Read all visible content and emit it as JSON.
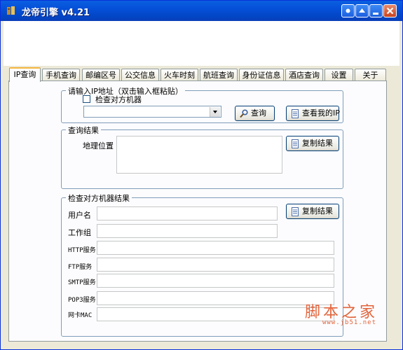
{
  "window": {
    "title": "龙帝引擎 v4.21"
  },
  "tabs": [
    {
      "label": "IP查询",
      "active": true
    },
    {
      "label": "手机查询"
    },
    {
      "label": "邮编区号"
    },
    {
      "label": "公交信息"
    },
    {
      "label": "火车时刻"
    },
    {
      "label": "航班查询"
    },
    {
      "label": "身份证信息"
    },
    {
      "label": "酒店查询"
    },
    {
      "label": "设置"
    },
    {
      "label": "关于"
    }
  ],
  "ip_input": {
    "legend": "请输入IP地址（双击输入框粘贴）",
    "check_remote_label": "检查对方机器",
    "check_remote_checked": false,
    "ip_value": "",
    "query_button": "查询",
    "view_my_ip_button": "查看我的IP"
  },
  "query_result": {
    "legend": "查询结果",
    "location_label": "地理位置",
    "location_value": "",
    "copy_button": "复制结果"
  },
  "remote_result": {
    "legend": "检查对方机器结果",
    "copy_button": "复制结果",
    "fields": {
      "username": "用户名",
      "workgroup": "工作组",
      "http": "HTTP服务",
      "ftp": "FTP服务",
      "smtp": "SMTP服务",
      "pop3": "POP3服务",
      "mac": "网卡MAC"
    }
  },
  "watermark": {
    "text": "脚本之家",
    "url": "www.jb51.net"
  }
}
